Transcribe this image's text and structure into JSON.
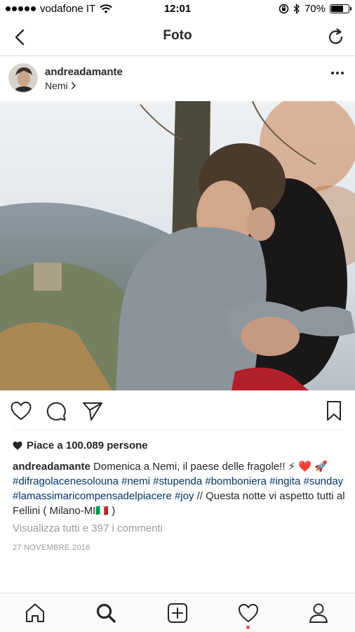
{
  "status_bar": {
    "carrier": "vodafone IT",
    "time": "12:01",
    "battery": "70%",
    "battery_level": 0.7
  },
  "nav": {
    "title": "Foto",
    "back_icon": "chevron-left-icon",
    "refresh_icon": "refresh-icon"
  },
  "post": {
    "username": "andreadamante",
    "location": "Nemi",
    "likes": "Piace a 100.089 persone",
    "caption": {
      "username": "andreadamante",
      "text1": " Domenica a Nemi, il paese delle fragole!! ⚡",
      "emojis": "❤️ 🚀 ",
      "tags1": "#difragolacenesolouna #nemi #stupenda #bomboniera #ingita #sunday #lamassimaricompensadelpiacere #joy",
      "text2": " // Questa notte vi aspetto tutti al Fellini ( Milano-MI🇮🇹 )"
    },
    "comments_link": "Visualizza tutti e 397 i commenti",
    "date": "27 NOVEMBRE 2016"
  },
  "actions": [
    "heart-icon",
    "comment-icon",
    "share-icon",
    "bookmark-icon"
  ],
  "tabs": [
    "home-icon",
    "search-icon",
    "add-icon",
    "activity-icon",
    "profile-icon"
  ],
  "colors": {
    "text": "#262626",
    "muted": "#999999",
    "hashtag": "#003569",
    "notification": "#ed4956"
  }
}
